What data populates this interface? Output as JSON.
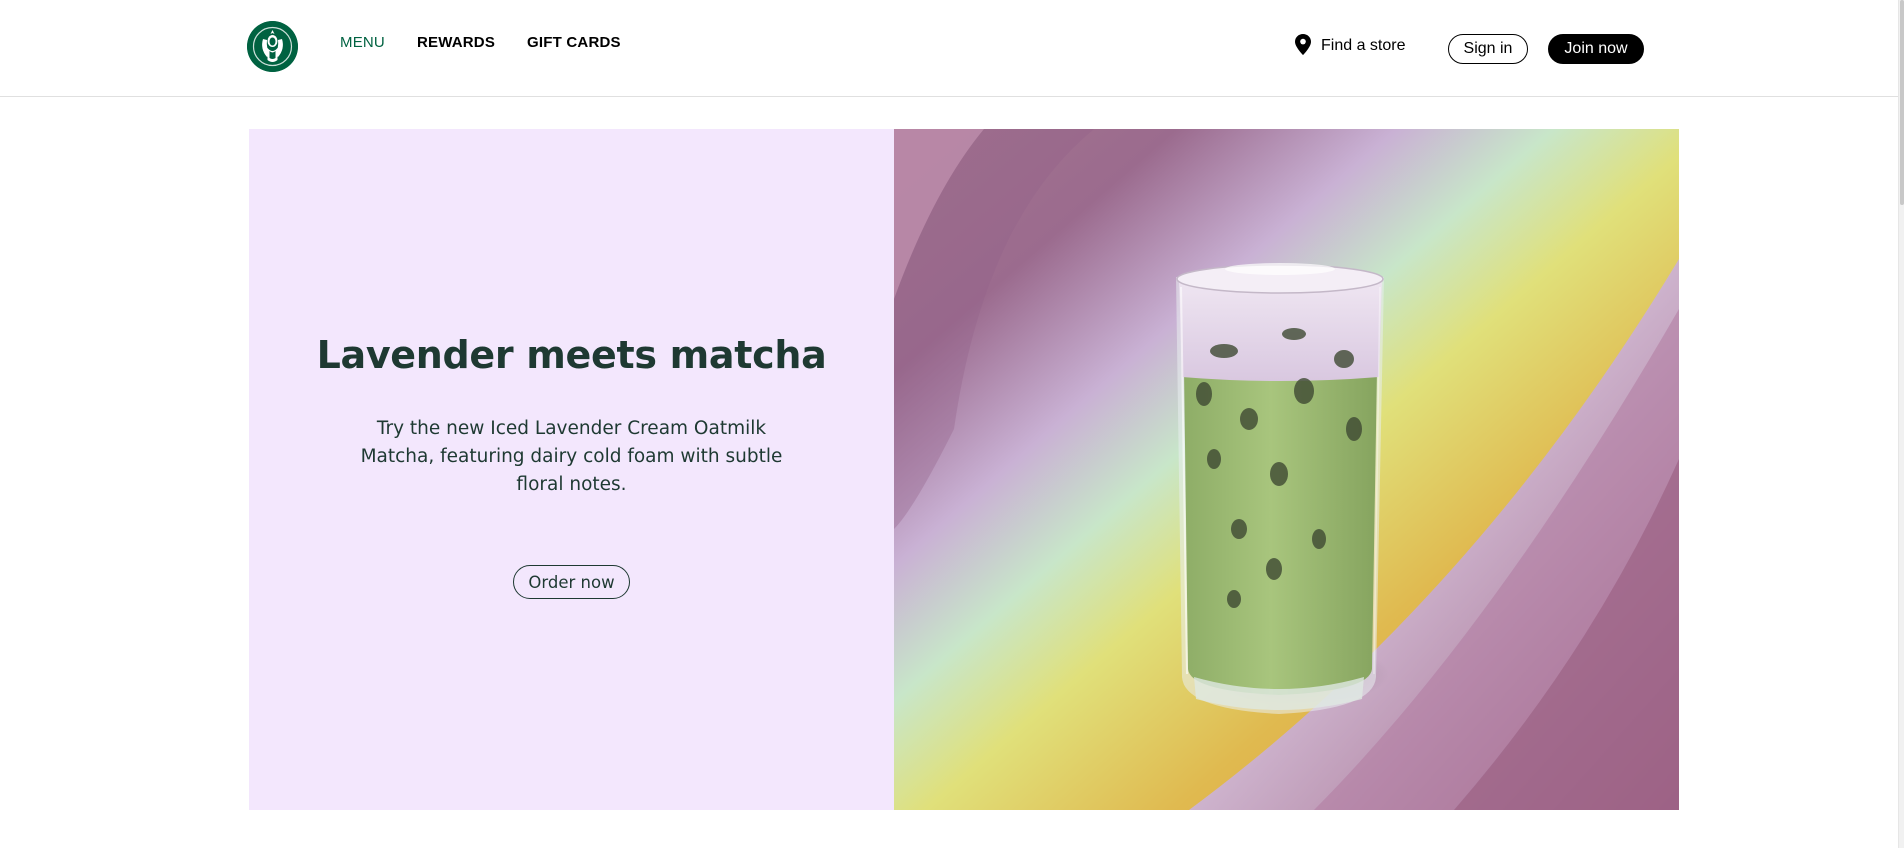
{
  "header": {
    "logo_icon": "starbucks-siren-logo",
    "nav": [
      {
        "label": "MENU",
        "active": true
      },
      {
        "label": "REWARDS",
        "active": false
      },
      {
        "label": "GIFT CARDS",
        "active": false
      }
    ],
    "find_store": {
      "icon": "location-pin-icon",
      "label": "Find a store"
    },
    "sign_in_label": "Sign in",
    "join_now_label": "Join now"
  },
  "hero": {
    "title": "Lavender meets matcha",
    "body": "Try the new Iced Lavender Cream Oatmilk Matcha, featuring dairy cold foam with subtle floral notes.",
    "cta_label": "Order now",
    "image": "iced-lavender-cream-oatmilk-matcha-drink",
    "colors": {
      "panel_bg": "#f3e7fd",
      "text": "#1e3932",
      "brand_green": "#006241"
    }
  }
}
